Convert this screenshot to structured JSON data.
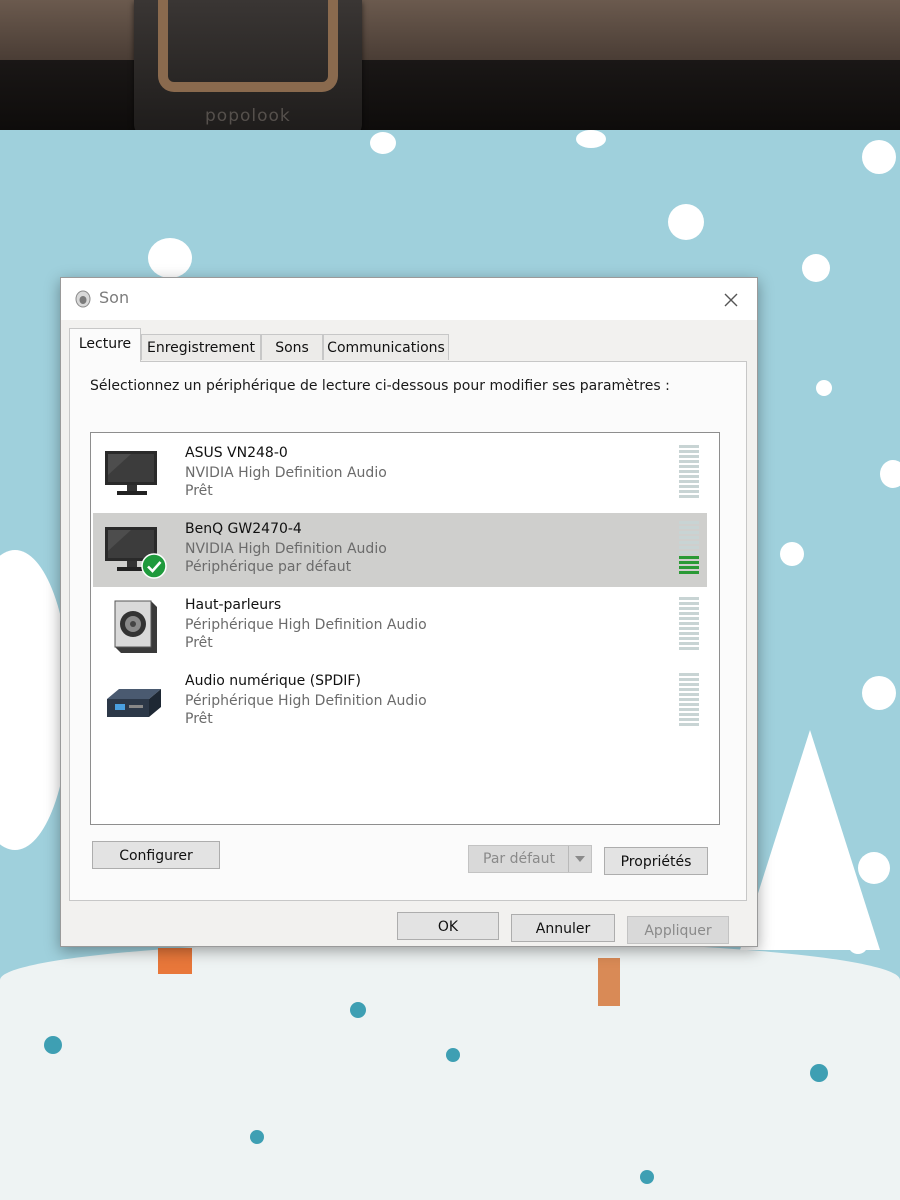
{
  "webcam": {
    "brand": "popolook"
  },
  "window": {
    "title": "Son",
    "close_icon": "close-icon"
  },
  "tabs": [
    {
      "label": "Lecture",
      "active": true
    },
    {
      "label": "Enregistrement",
      "active": false
    },
    {
      "label": "Sons",
      "active": false
    },
    {
      "label": "Communications",
      "active": false
    }
  ],
  "instruction": "Sélectionnez un périphérique de lecture ci-dessous pour modifier ses paramètres :",
  "devices": [
    {
      "name": "ASUS VN248-0",
      "description": "NVIDIA High Definition Audio",
      "status": "Prêt",
      "icon": "monitor-icon",
      "selected": false,
      "level": 0
    },
    {
      "name": "BenQ GW2470-4",
      "description": "NVIDIA High Definition Audio",
      "status": "Périphérique par défaut",
      "icon": "monitor-icon",
      "default_badge": "check-icon",
      "selected": true,
      "level": 0.35
    },
    {
      "name": "Haut-parleurs",
      "description": "Périphérique High Definition Audio",
      "status": "Prêt",
      "icon": "speaker-icon",
      "selected": false,
      "level": 0
    },
    {
      "name": "Audio numérique (SPDIF)",
      "description": "Périphérique High Definition Audio",
      "status": "Prêt",
      "icon": "digital-audio-icon",
      "selected": false,
      "level": 0
    }
  ],
  "buttons": {
    "configure": "Configurer",
    "set_default": "Par défaut",
    "properties": "Propriétés",
    "ok": "OK",
    "cancel": "Annuler",
    "apply": "Appliquer"
  },
  "colors": {
    "meter_on": "#2a9a36",
    "meter_off": "#c8d4d4",
    "selected_row": "#cfcfcd"
  }
}
